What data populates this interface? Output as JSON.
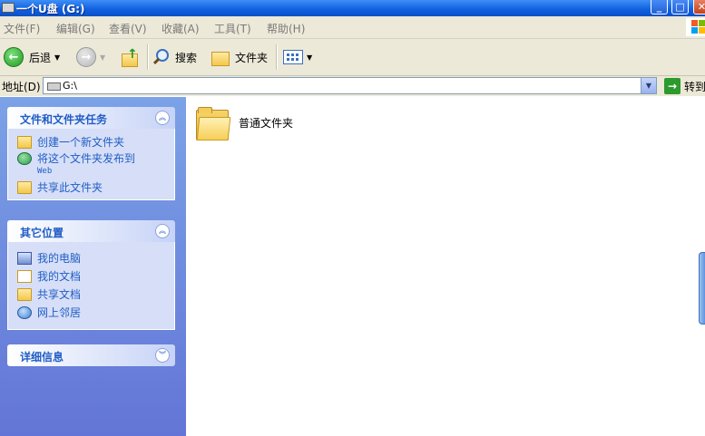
{
  "window": {
    "title": "一个U盘 (G:)",
    "buttons": {
      "minimize": "_",
      "maximize": "□",
      "close": "✕"
    }
  },
  "menu": [
    "文件(F)",
    "编辑(G)",
    "查看(V)",
    "收藏(A)",
    "工具(T)",
    "帮助(H)"
  ],
  "toolbar": {
    "back_label": "后退",
    "search_label": "搜索",
    "folders_label": "文件夹"
  },
  "address": {
    "label": "地址(D)",
    "value": "G:\\",
    "go_label": "转到"
  },
  "sidebar": {
    "tasks": {
      "title": "文件和文件夹任务",
      "items": [
        {
          "label": "创建一个新文件夹",
          "icon": "new-folder-icon"
        },
        {
          "label": "将这个文件夹发布到",
          "sub": "Web",
          "icon": "publish-web-icon"
        },
        {
          "label": "共享此文件夹",
          "icon": "share-folder-icon"
        }
      ]
    },
    "places": {
      "title": "其它位置",
      "items": [
        {
          "label": "我的电脑",
          "icon": "my-computer-icon"
        },
        {
          "label": "我的文档",
          "icon": "my-documents-icon"
        },
        {
          "label": "共享文档",
          "icon": "shared-documents-icon"
        },
        {
          "label": "网上邻居",
          "icon": "network-places-icon"
        }
      ]
    },
    "details": {
      "title": "详细信息"
    }
  },
  "files": [
    {
      "name": "普通文件夹",
      "icon": "folder-icon"
    }
  ],
  "colors": {
    "titlebar": "#0f5fe0",
    "sidebar": "#6f8fde",
    "link": "#215dc6"
  }
}
